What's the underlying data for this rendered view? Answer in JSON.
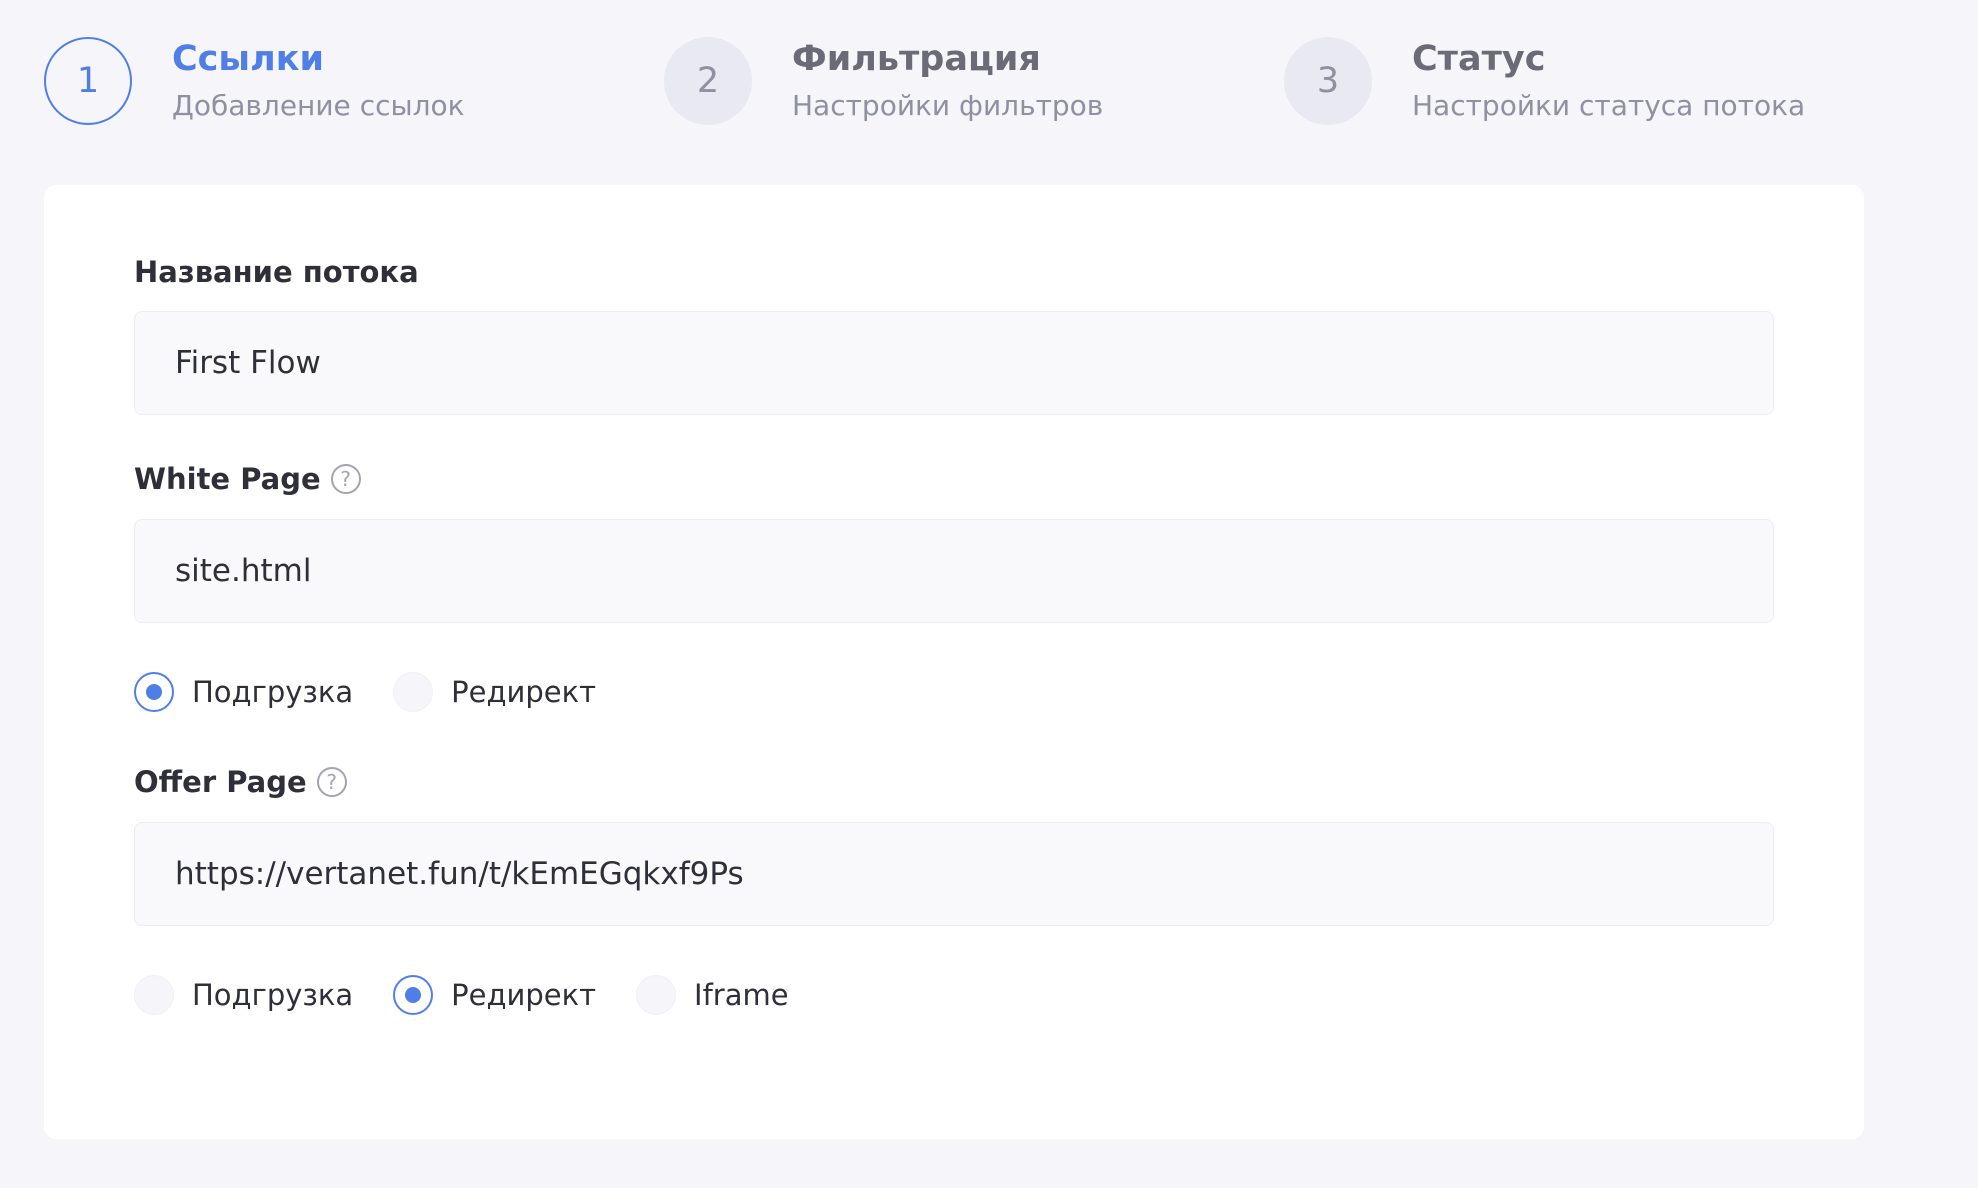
{
  "stepper": {
    "steps": [
      {
        "number": "1",
        "title": "Ссылки",
        "subtitle": "Добавление ссылок",
        "active": true
      },
      {
        "number": "2",
        "title": "Фильтрация",
        "subtitle": "Настройки фильтров",
        "active": false
      },
      {
        "number": "3",
        "title": "Статус",
        "subtitle": "Настройки статуса потока",
        "active": false
      }
    ]
  },
  "form": {
    "flow_name": {
      "label": "Название потока",
      "value": "First Flow"
    },
    "white_page": {
      "label": "White Page",
      "help_icon": "question-circle-icon",
      "value": "site.html",
      "options": [
        "Подгрузка",
        "Редирект"
      ],
      "selected": "Подгрузка"
    },
    "offer_page": {
      "label": "Offer Page",
      "help_icon": "question-circle-icon",
      "value": "https://vertanet.fun/t/kEmEGqkxf9Ps",
      "options": [
        "Подгрузка",
        "Редирект",
        "Iframe"
      ],
      "selected": "Редирект"
    }
  },
  "colors": {
    "accent": "#4f7fe6",
    "background": "#f5f5fa",
    "card": "#ffffff",
    "text": "#2f2f3a",
    "muted": "#8f90a0"
  }
}
